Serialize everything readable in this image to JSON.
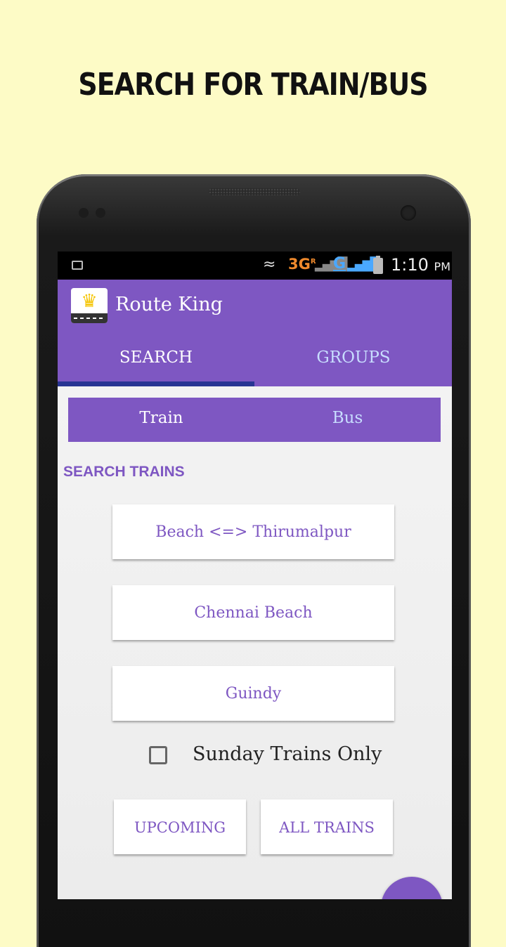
{
  "promo": {
    "title": "SEARCH FOR TRAIN/BUS"
  },
  "statusbar": {
    "network_3g": "3G",
    "network_3g_sup": "R",
    "network_g": "G",
    "time": "1:10",
    "ampm": "PM",
    "icons": [
      "image-icon",
      "wifi-icon",
      "signal-icon",
      "battery-icon"
    ]
  },
  "appbar": {
    "title": "Route King",
    "icon": "crown-icon",
    "color": "#7e57c2",
    "tabs": [
      {
        "label": "SEARCH",
        "selected": true
      },
      {
        "label": "GROUPS",
        "selected": false
      }
    ]
  },
  "mode": {
    "options": [
      {
        "label": "Train",
        "selected": true
      },
      {
        "label": "Bus",
        "selected": false
      }
    ]
  },
  "search": {
    "section_label": "SEARCH TRAINS",
    "route": "Beach <=> Thirumalpur",
    "from": "Chennai Beach",
    "to": "Guindy",
    "sunday_only_label": "Sunday Trains Only",
    "sunday_only_checked": false,
    "upcoming_label": "UPCOMING",
    "all_trains_label": "ALL TRAINS"
  }
}
